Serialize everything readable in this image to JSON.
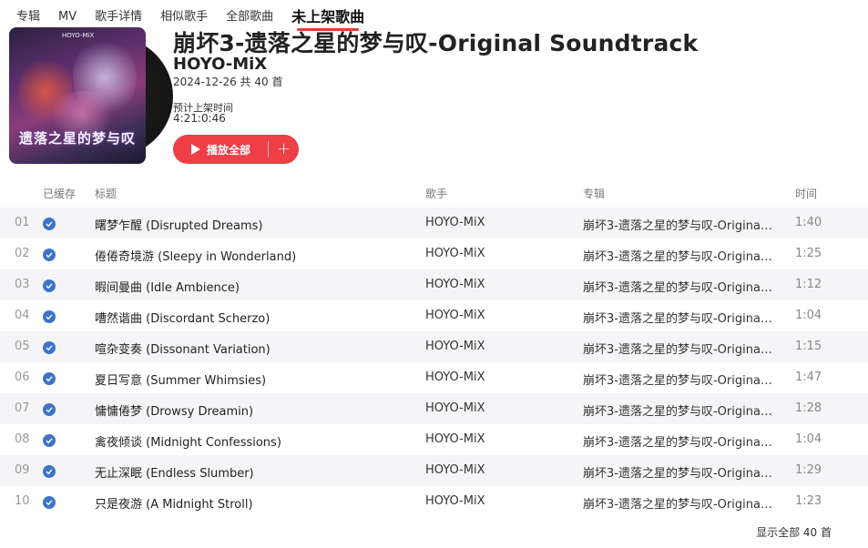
{
  "tabs": [
    {
      "label": "专辑"
    },
    {
      "label": "MV"
    },
    {
      "label": "歌手详情"
    },
    {
      "label": "相似歌手"
    },
    {
      "label": "全部歌曲"
    },
    {
      "label": "未上架歌曲",
      "active": true
    }
  ],
  "album": {
    "title": "崩坏3-遗落之星的梦与叹-Original Soundtrack",
    "artist": "HOYO-MiX",
    "meta": "2024-12-26 共 40 首",
    "pre_label": "预计上架时间",
    "countdown": "4:21:0:46",
    "cover_logo": "HOYO-MiX",
    "cover_text": "遗落之星的梦与叹"
  },
  "actions": {
    "play_all": "播放全部",
    "add": "+"
  },
  "table": {
    "headers": {
      "cached": "已缓存",
      "title": "标题",
      "artist": "歌手",
      "album": "专辑",
      "time": "时间"
    },
    "rows": [
      {
        "idx": "01",
        "title": "曙梦乍醒 (Disrupted Dreams)",
        "artist": "HOYO-MiX",
        "album": "崩坏3-遗落之星的梦与叹-Origina…",
        "time": "1:40"
      },
      {
        "idx": "02",
        "title": "倦倦奇境游 (Sleepy in Wonderland)",
        "artist": "HOYO-MiX",
        "album": "崩坏3-遗落之星的梦与叹-Origina…",
        "time": "1:25"
      },
      {
        "idx": "03",
        "title": "暇间曼曲 (Idle Ambience)",
        "artist": "HOYO-MiX",
        "album": "崩坏3-遗落之星的梦与叹-Origina…",
        "time": "1:12"
      },
      {
        "idx": "04",
        "title": "嘈然谐曲 (Discordant Scherzo)",
        "artist": "HOYO-MiX",
        "album": "崩坏3-遗落之星的梦与叹-Origina…",
        "time": "1:04"
      },
      {
        "idx": "05",
        "title": "喧杂变奏 (Dissonant Variation)",
        "artist": "HOYO-MiX",
        "album": "崩坏3-遗落之星的梦与叹-Origina…",
        "time": "1:15"
      },
      {
        "idx": "06",
        "title": "夏日写意 (Summer Whimsies)",
        "artist": "HOYO-MiX",
        "album": "崩坏3-遗落之星的梦与叹-Origina…",
        "time": "1:47"
      },
      {
        "idx": "07",
        "title": "慵慵倦梦 (Drowsy Dreamin)",
        "artist": "HOYO-MiX",
        "album": "崩坏3-遗落之星的梦与叹-Origina…",
        "time": "1:28"
      },
      {
        "idx": "08",
        "title": "禽夜倾谈 (Midnight Confessions)",
        "artist": "HOYO-MiX",
        "album": "崩坏3-遗落之星的梦与叹-Origina…",
        "time": "1:04"
      },
      {
        "idx": "09",
        "title": "无止深眠 (Endless Slumber)",
        "artist": "HOYO-MiX",
        "album": "崩坏3-遗落之星的梦与叹-Origina…",
        "time": "1:29"
      },
      {
        "idx": "10",
        "title": "只是夜游 (A Midnight Stroll)",
        "artist": "HOYO-MiX",
        "album": "崩坏3-遗落之星的梦与叹-Origina…",
        "time": "1:23"
      }
    ]
  },
  "footer": {
    "show_all": "显示全部 40 首"
  },
  "colors": {
    "accent": "#ee3f47",
    "cached_badge": "#3d74c9",
    "row_stripe": "#f5f5f7"
  },
  "icons": {
    "play": "play-icon",
    "add": "plus-icon",
    "cached": "check-circle-icon"
  }
}
